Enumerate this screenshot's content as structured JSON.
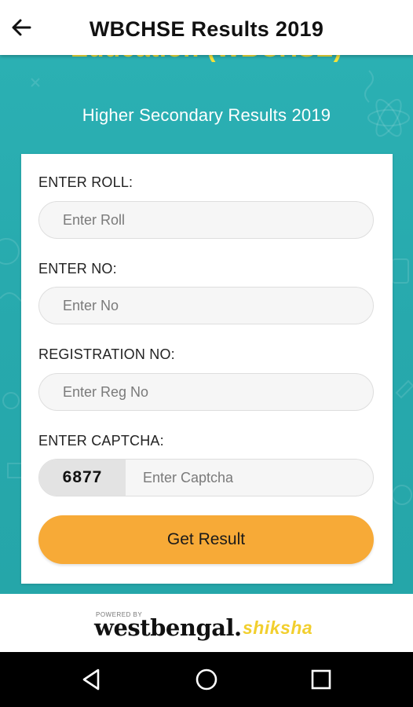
{
  "appbar": {
    "title": "WBCHSE Results 2019",
    "back_icon": "arrow-left-icon"
  },
  "hero": {
    "board_text": "Education (WBCHSE)",
    "subtitle": "Higher Secondary Results 2019"
  },
  "form": {
    "roll_label": "ENTER ROLL:",
    "roll_placeholder": "Enter Roll",
    "no_label": "ENTER NO:",
    "no_placeholder": "Enter No",
    "reg_label": "REGISTRATION NO:",
    "reg_placeholder": "Enter Reg No",
    "captcha_label": "ENTER CAPTCHA:",
    "captcha_code": "6877",
    "captcha_placeholder": "Enter Captcha",
    "submit_label": "Get Result"
  },
  "footer": {
    "powered_by": "POWERED BY",
    "brand_main": "westbengal.",
    "brand_sub": "shiksha"
  },
  "navbar": {
    "back_icon": "triangle-back-icon",
    "home_icon": "circle-home-icon",
    "recents_icon": "square-recents-icon"
  },
  "colors": {
    "hero_bg": "#2aadb0",
    "board_text": "#f3e23b",
    "button": "#f7aa37",
    "brand_accent": "#f2cf2e"
  }
}
